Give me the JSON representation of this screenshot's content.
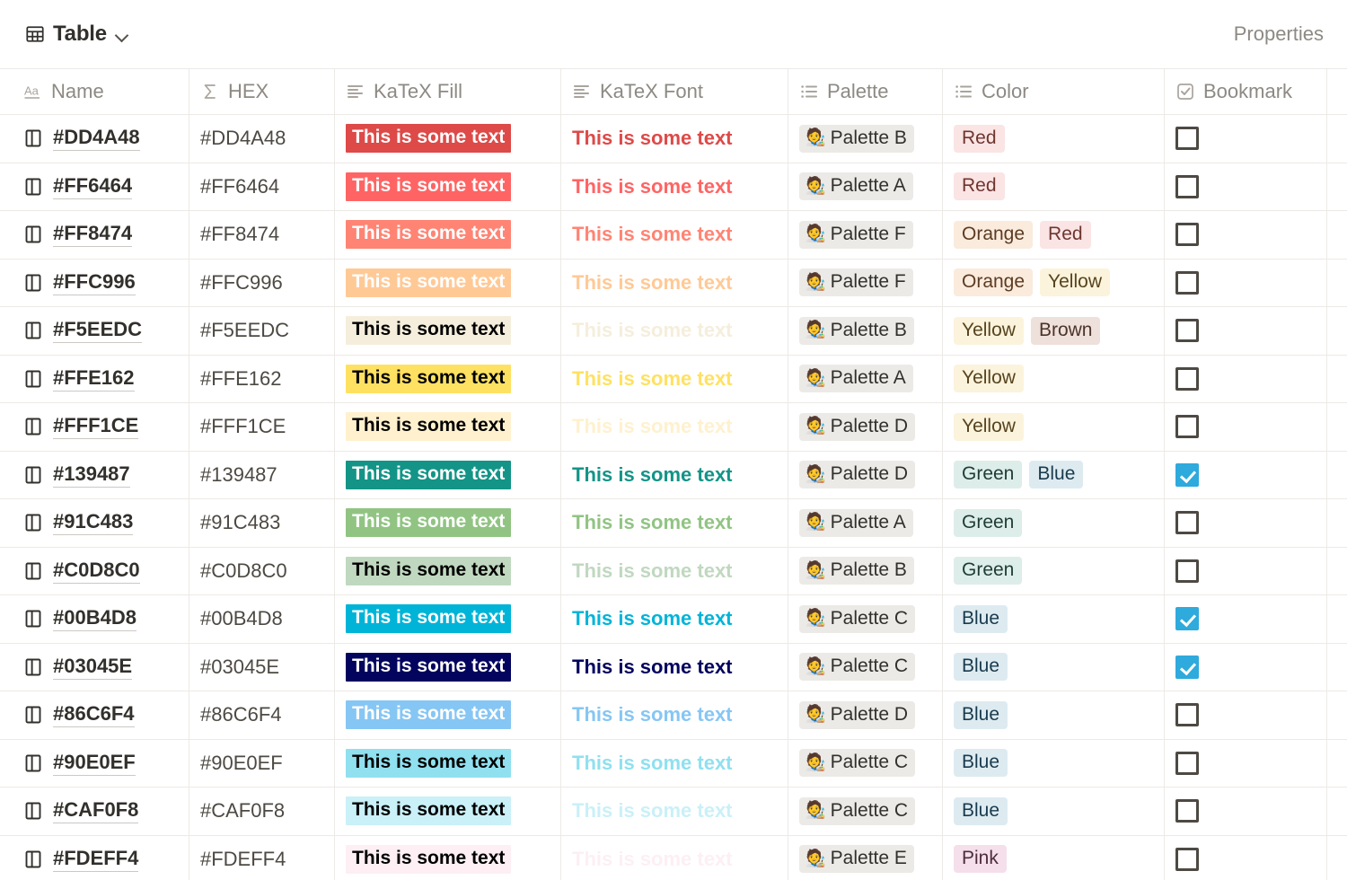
{
  "topbar": {
    "view_icon": "table-icon",
    "view_title": "Table",
    "chevron": "chevron-down-icon",
    "properties_label": "Properties"
  },
  "table": {
    "columns": [
      {
        "key": "name",
        "label": "Name",
        "icon": "text-aa-icon"
      },
      {
        "key": "hex",
        "label": "HEX",
        "icon": "sigma-icon"
      },
      {
        "key": "fill",
        "label": "KaTeX Fill",
        "icon": "text-lines-icon"
      },
      {
        "key": "font",
        "label": "KaTeX Font",
        "icon": "text-lines-icon"
      },
      {
        "key": "palette",
        "label": "Palette",
        "icon": "bulleted-list-icon"
      },
      {
        "key": "color",
        "label": "Color",
        "icon": "bulleted-list-icon"
      },
      {
        "key": "bookmark",
        "label": "Bookmark",
        "icon": "checkbox-icon"
      }
    ],
    "sample_text": "This is some text",
    "rows": [
      {
        "name": "#DD4A48",
        "hex": "#DD4A48",
        "fill_bg": "#DD4A48",
        "fill_fg": "#FFFFFF",
        "font_color": "#DD4A48",
        "palette": "Palette B",
        "colors": [
          "Red"
        ],
        "bookmark": false
      },
      {
        "name": "#FF6464",
        "hex": "#FF6464",
        "fill_bg": "#FF6464",
        "fill_fg": "#FFFFFF",
        "font_color": "#FF6464",
        "palette": "Palette A",
        "colors": [
          "Red"
        ],
        "bookmark": false
      },
      {
        "name": "#FF8474",
        "hex": "#FF8474",
        "fill_bg": "#FF8474",
        "fill_fg": "#FFFFFF",
        "font_color": "#FF8474",
        "palette": "Palette F",
        "colors": [
          "Orange",
          "Red"
        ],
        "bookmark": false
      },
      {
        "name": "#FFC996",
        "hex": "#FFC996",
        "fill_bg": "#FFC996",
        "fill_fg": "#FFFFFF",
        "font_color": "#FFC996",
        "palette": "Palette F",
        "colors": [
          "Orange",
          "Yellow"
        ],
        "bookmark": false
      },
      {
        "name": "#F5EEDC",
        "hex": "#F5EEDC",
        "fill_bg": "#F5EEDC",
        "fill_fg": "#000000",
        "font_color": "#F5EEDC",
        "palette": "Palette B",
        "colors": [
          "Yellow",
          "Brown"
        ],
        "bookmark": false
      },
      {
        "name": "#FFE162",
        "hex": "#FFE162",
        "fill_bg": "#FFE162",
        "fill_fg": "#000000",
        "font_color": "#FFE162",
        "palette": "Palette A",
        "colors": [
          "Yellow"
        ],
        "bookmark": false
      },
      {
        "name": "#FFF1CE",
        "hex": "#FFF1CE",
        "fill_bg": "#FFF1CE",
        "fill_fg": "#000000",
        "font_color": "#FFF1CE",
        "palette": "Palette D",
        "colors": [
          "Yellow"
        ],
        "bookmark": false
      },
      {
        "name": "#139487",
        "hex": "#139487",
        "fill_bg": "#139487",
        "fill_fg": "#FFFFFF",
        "font_color": "#139487",
        "palette": "Palette D",
        "colors": [
          "Green",
          "Blue"
        ],
        "bookmark": true
      },
      {
        "name": "#91C483",
        "hex": "#91C483",
        "fill_bg": "#91C483",
        "fill_fg": "#FFFFFF",
        "font_color": "#91C483",
        "palette": "Palette A",
        "colors": [
          "Green"
        ],
        "bookmark": false
      },
      {
        "name": "#C0D8C0",
        "hex": "#C0D8C0",
        "fill_bg": "#C0D8C0",
        "fill_fg": "#000000",
        "font_color": "#C0D8C0",
        "palette": "Palette B",
        "colors": [
          "Green"
        ],
        "bookmark": false
      },
      {
        "name": "#00B4D8",
        "hex": "#00B4D8",
        "fill_bg": "#00B4D8",
        "fill_fg": "#FFFFFF",
        "font_color": "#00B4D8",
        "palette": "Palette C",
        "colors": [
          "Blue"
        ],
        "bookmark": true
      },
      {
        "name": "#03045E",
        "hex": "#03045E",
        "fill_bg": "#03045E",
        "fill_fg": "#FFFFFF",
        "font_color": "#03045E",
        "palette": "Palette C",
        "colors": [
          "Blue"
        ],
        "bookmark": true
      },
      {
        "name": "#86C6F4",
        "hex": "#86C6F4",
        "fill_bg": "#86C6F4",
        "fill_fg": "#FFFFFF",
        "font_color": "#86C6F4",
        "palette": "Palette D",
        "colors": [
          "Blue"
        ],
        "bookmark": false
      },
      {
        "name": "#90E0EF",
        "hex": "#90E0EF",
        "fill_bg": "#90E0EF",
        "fill_fg": "#000000",
        "font_color": "#90E0EF",
        "palette": "Palette C",
        "colors": [
          "Blue"
        ],
        "bookmark": false
      },
      {
        "name": "#CAF0F8",
        "hex": "#CAF0F8",
        "fill_bg": "#CAF0F8",
        "fill_fg": "#000000",
        "font_color": "#CAF0F8",
        "palette": "Palette C",
        "colors": [
          "Blue"
        ],
        "bookmark": false
      },
      {
        "name": "#FDEFF4",
        "hex": "#FDEFF4",
        "fill_bg": "#FDEFF4",
        "fill_fg": "#000000",
        "font_color": "#FDEFF4",
        "palette": "Palette E",
        "colors": [
          "Pink"
        ],
        "bookmark": false
      }
    ]
  }
}
